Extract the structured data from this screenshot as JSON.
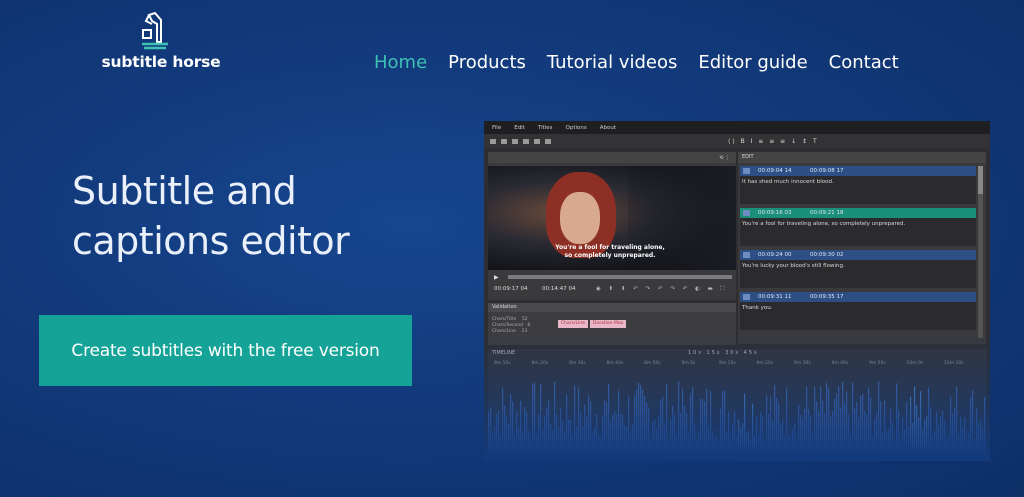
{
  "header": {
    "logo_text": "subtitle horse",
    "nav": [
      {
        "label": "Home",
        "active": true
      },
      {
        "label": "Products",
        "active": false
      },
      {
        "label": "Tutorial videos",
        "active": false
      },
      {
        "label": "Editor guide",
        "active": false
      },
      {
        "label": "Contact",
        "active": false
      }
    ]
  },
  "hero": {
    "title_line1": "Subtitle and",
    "title_line2": "captions editor",
    "cta_label": "Create subtitles with the free version"
  },
  "colors": {
    "accent": "#14a396",
    "nav_active": "#3ec0b4",
    "background": "#123a7c"
  },
  "app": {
    "menu": [
      "File",
      "Edit",
      "Titles",
      "Options",
      "About"
    ],
    "video_subtitle_line1": "You're a fool for traveling alone,",
    "video_subtitle_line2": "so completely unprepared.",
    "current_time": "00:09:17 04",
    "duration": "00:14:47 04",
    "validation_label": "Validation",
    "validation_rows": [
      "Chars/Title",
      "Chars/Second",
      "Chars/Line"
    ],
    "validation_values": [
      "52",
      "8",
      "23"
    ],
    "validation_tags": [
      "Chars/Line",
      "Duration Max"
    ],
    "edit_label": "EDIT",
    "subtitles": [
      {
        "index": "1",
        "start": "00:09:04 14",
        "end": "00:09:08 17",
        "text": "It has shed much innocent blood.",
        "active": false
      },
      {
        "index": "2",
        "start": "00:09:16 03",
        "end": "00:09:21 18",
        "text": "You're a fool for traveling alone, so completely unprepared.",
        "active": true
      },
      {
        "index": "3",
        "start": "00:09:24 00",
        "end": "00:09:30 02",
        "text": "You're lucky your blood's still flowing.",
        "active": false
      },
      {
        "index": "4",
        "start": "00:09:31 11",
        "end": "00:09:35 17",
        "text": "Thank you.",
        "active": false
      }
    ],
    "timeline_label": "TIMELINE",
    "timeline_zoom": "10s 15s 30s 45s",
    "ruler": [
      "8m 10s",
      "8m 20s",
      "8m 30s",
      "8m 40s",
      "8m 50s",
      "9m 0s",
      "9m 10s",
      "9m 20s",
      "9m 30s",
      "9m 40s",
      "9m 50s",
      "10m 0s",
      "10m 10s"
    ]
  }
}
